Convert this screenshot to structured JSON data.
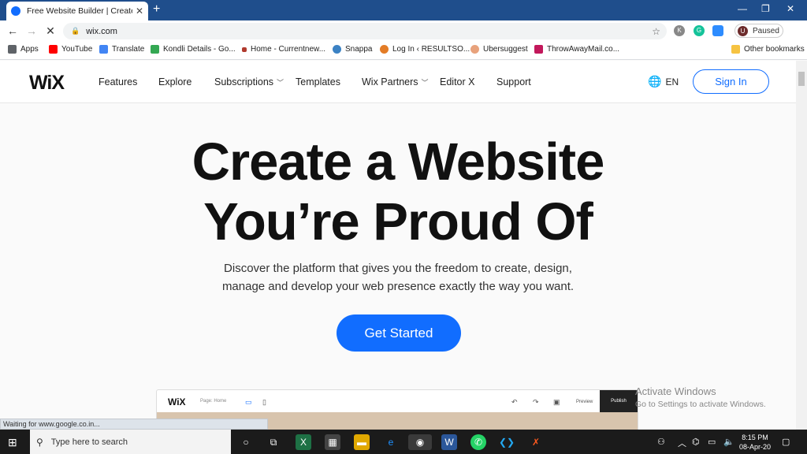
{
  "browser": {
    "tab_title": "Free Website Builder | Create a F",
    "tab_close": "✕",
    "new_tab": "+",
    "url": "wix.com",
    "profile_initial": "U",
    "profile_status": "Paused",
    "bookmarks": [
      "Apps",
      "YouTube",
      "Translate",
      "Kondli Details - Go...",
      "Home - Currentnew...",
      "Snappa",
      "Log In ‹ RESULTSO...",
      "Ubersuggest",
      "ThrowAwayMail.co..."
    ],
    "other_bookmarks": "Other bookmarks",
    "extensions": [
      "K",
      "G"
    ],
    "status_text": "Waiting for www.google.co.in..."
  },
  "site": {
    "logo": "WiX",
    "nav": [
      {
        "label": "Features",
        "dropdown": false
      },
      {
        "label": "Explore",
        "dropdown": false
      },
      {
        "label": "Subscriptions",
        "dropdown": true
      },
      {
        "label": "Templates",
        "dropdown": false
      },
      {
        "label": "Wix Partners",
        "dropdown": true
      },
      {
        "label": "Editor X",
        "dropdown": false
      },
      {
        "label": "Support",
        "dropdown": false
      }
    ],
    "language": "EN",
    "sign_in": "Sign In",
    "headline_line1": "Create a Website",
    "headline_line2": "You’re Proud Of",
    "subtext_line1": "Discover the platform that gives you the freedom to create, design,",
    "subtext_line2": "manage and develop your web presence exactly the way you want.",
    "cta": "Get Started",
    "accent_color": "#116dff"
  },
  "editor_preview": {
    "logo": "WiX",
    "page_selector": "Page: Home",
    "preview_label": "Preview",
    "publish_label": "Publish"
  },
  "windows": {
    "watermark_title": "Activate Windows",
    "watermark_sub": "Go to Settings to activate Windows.",
    "search_placeholder": "Type here to search",
    "time": "8:15 PM",
    "date": "08-Apr-20"
  }
}
